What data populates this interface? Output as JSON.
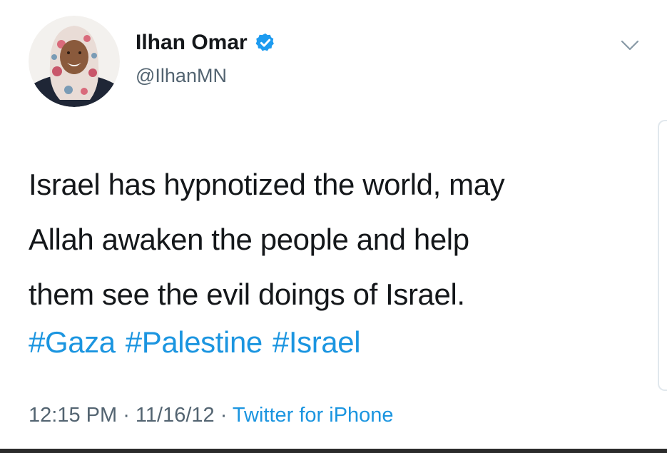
{
  "author": {
    "display_name": "Ilhan Omar",
    "handle": "@IlhanMN",
    "verified": true,
    "avatar_icon": "profile-photo"
  },
  "tweet": {
    "lines": [
      "Israel has hypnotized the world, may",
      "Allah awaken the people and help",
      "them see the evil doings of Israel."
    ],
    "hashtags": [
      "#Gaza",
      "#Palestine",
      "#Israel"
    ]
  },
  "meta": {
    "time": "12:15 PM",
    "date": "11/16/12",
    "separator": " · ",
    "source": "Twitter for iPhone"
  },
  "icons": {
    "verified": "verified-badge-icon",
    "menu": "chevron-down-icon"
  },
  "colors": {
    "link": "#1b95e0",
    "verified": "#1d9bf0",
    "text": "#14171a",
    "secondary": "#536471"
  }
}
